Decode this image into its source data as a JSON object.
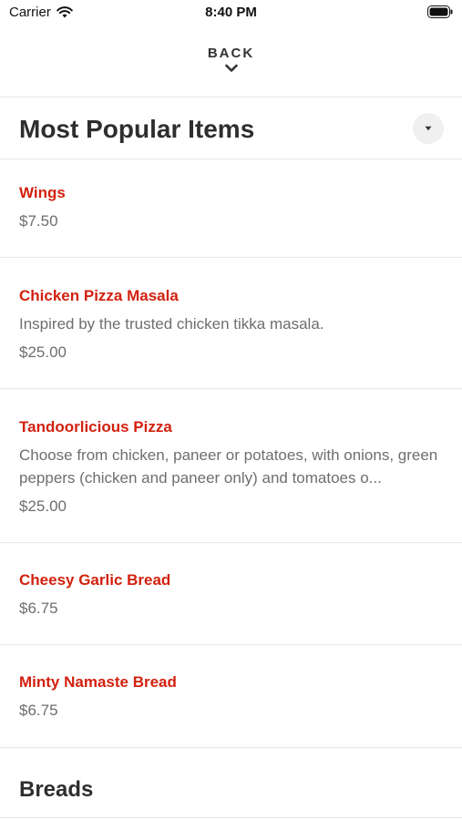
{
  "status_bar": {
    "carrier": "Carrier",
    "time": "8:40 PM"
  },
  "header": {
    "back_label": "BACK"
  },
  "section": {
    "title": "Most Popular Items"
  },
  "items": [
    {
      "name": "Wings",
      "description": "",
      "price": "$7.50"
    },
    {
      "name": "Chicken Pizza Masala",
      "description": "Inspired by the trusted chicken tikka masala.",
      "price": "$25.00"
    },
    {
      "name": "Tandoorlicious Pizza",
      "description": "Choose from chicken, paneer or potatoes, with onions, green peppers (chicken and paneer only) and tomatoes o...",
      "price": "$25.00"
    },
    {
      "name": "Cheesy Garlic Bread",
      "description": "",
      "price": "$6.75"
    },
    {
      "name": "Minty Namaste Bread",
      "description": "",
      "price": "$6.75"
    }
  ],
  "next_section": {
    "title": "Breads"
  },
  "colors": {
    "accent": "#d2210f",
    "muted_text": "#6e6e6e",
    "divider": "#e8e8e8"
  }
}
